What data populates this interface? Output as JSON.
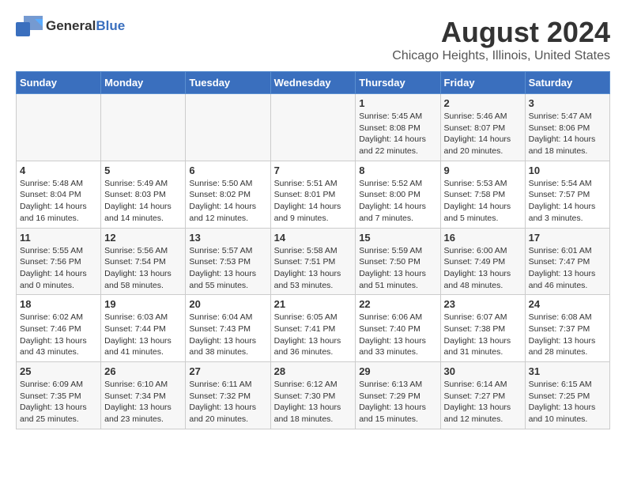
{
  "header": {
    "logo_general": "General",
    "logo_blue": "Blue",
    "title": "August 2024",
    "subtitle": "Chicago Heights, Illinois, United States"
  },
  "days_of_week": [
    "Sunday",
    "Monday",
    "Tuesday",
    "Wednesday",
    "Thursday",
    "Friday",
    "Saturday"
  ],
  "weeks": [
    [
      {
        "day": "",
        "info": ""
      },
      {
        "day": "",
        "info": ""
      },
      {
        "day": "",
        "info": ""
      },
      {
        "day": "",
        "info": ""
      },
      {
        "day": "1",
        "info": "Sunrise: 5:45 AM\nSunset: 8:08 PM\nDaylight: 14 hours\nand 22 minutes."
      },
      {
        "day": "2",
        "info": "Sunrise: 5:46 AM\nSunset: 8:07 PM\nDaylight: 14 hours\nand 20 minutes."
      },
      {
        "day": "3",
        "info": "Sunrise: 5:47 AM\nSunset: 8:06 PM\nDaylight: 14 hours\nand 18 minutes."
      }
    ],
    [
      {
        "day": "4",
        "info": "Sunrise: 5:48 AM\nSunset: 8:04 PM\nDaylight: 14 hours\nand 16 minutes."
      },
      {
        "day": "5",
        "info": "Sunrise: 5:49 AM\nSunset: 8:03 PM\nDaylight: 14 hours\nand 14 minutes."
      },
      {
        "day": "6",
        "info": "Sunrise: 5:50 AM\nSunset: 8:02 PM\nDaylight: 14 hours\nand 12 minutes."
      },
      {
        "day": "7",
        "info": "Sunrise: 5:51 AM\nSunset: 8:01 PM\nDaylight: 14 hours\nand 9 minutes."
      },
      {
        "day": "8",
        "info": "Sunrise: 5:52 AM\nSunset: 8:00 PM\nDaylight: 14 hours\nand 7 minutes."
      },
      {
        "day": "9",
        "info": "Sunrise: 5:53 AM\nSunset: 7:58 PM\nDaylight: 14 hours\nand 5 minutes."
      },
      {
        "day": "10",
        "info": "Sunrise: 5:54 AM\nSunset: 7:57 PM\nDaylight: 14 hours\nand 3 minutes."
      }
    ],
    [
      {
        "day": "11",
        "info": "Sunrise: 5:55 AM\nSunset: 7:56 PM\nDaylight: 14 hours\nand 0 minutes."
      },
      {
        "day": "12",
        "info": "Sunrise: 5:56 AM\nSunset: 7:54 PM\nDaylight: 13 hours\nand 58 minutes."
      },
      {
        "day": "13",
        "info": "Sunrise: 5:57 AM\nSunset: 7:53 PM\nDaylight: 13 hours\nand 55 minutes."
      },
      {
        "day": "14",
        "info": "Sunrise: 5:58 AM\nSunset: 7:51 PM\nDaylight: 13 hours\nand 53 minutes."
      },
      {
        "day": "15",
        "info": "Sunrise: 5:59 AM\nSunset: 7:50 PM\nDaylight: 13 hours\nand 51 minutes."
      },
      {
        "day": "16",
        "info": "Sunrise: 6:00 AM\nSunset: 7:49 PM\nDaylight: 13 hours\nand 48 minutes."
      },
      {
        "day": "17",
        "info": "Sunrise: 6:01 AM\nSunset: 7:47 PM\nDaylight: 13 hours\nand 46 minutes."
      }
    ],
    [
      {
        "day": "18",
        "info": "Sunrise: 6:02 AM\nSunset: 7:46 PM\nDaylight: 13 hours\nand 43 minutes."
      },
      {
        "day": "19",
        "info": "Sunrise: 6:03 AM\nSunset: 7:44 PM\nDaylight: 13 hours\nand 41 minutes."
      },
      {
        "day": "20",
        "info": "Sunrise: 6:04 AM\nSunset: 7:43 PM\nDaylight: 13 hours\nand 38 minutes."
      },
      {
        "day": "21",
        "info": "Sunrise: 6:05 AM\nSunset: 7:41 PM\nDaylight: 13 hours\nand 36 minutes."
      },
      {
        "day": "22",
        "info": "Sunrise: 6:06 AM\nSunset: 7:40 PM\nDaylight: 13 hours\nand 33 minutes."
      },
      {
        "day": "23",
        "info": "Sunrise: 6:07 AM\nSunset: 7:38 PM\nDaylight: 13 hours\nand 31 minutes."
      },
      {
        "day": "24",
        "info": "Sunrise: 6:08 AM\nSunset: 7:37 PM\nDaylight: 13 hours\nand 28 minutes."
      }
    ],
    [
      {
        "day": "25",
        "info": "Sunrise: 6:09 AM\nSunset: 7:35 PM\nDaylight: 13 hours\nand 25 minutes."
      },
      {
        "day": "26",
        "info": "Sunrise: 6:10 AM\nSunset: 7:34 PM\nDaylight: 13 hours\nand 23 minutes."
      },
      {
        "day": "27",
        "info": "Sunrise: 6:11 AM\nSunset: 7:32 PM\nDaylight: 13 hours\nand 20 minutes."
      },
      {
        "day": "28",
        "info": "Sunrise: 6:12 AM\nSunset: 7:30 PM\nDaylight: 13 hours\nand 18 minutes."
      },
      {
        "day": "29",
        "info": "Sunrise: 6:13 AM\nSunset: 7:29 PM\nDaylight: 13 hours\nand 15 minutes."
      },
      {
        "day": "30",
        "info": "Sunrise: 6:14 AM\nSunset: 7:27 PM\nDaylight: 13 hours\nand 12 minutes."
      },
      {
        "day": "31",
        "info": "Sunrise: 6:15 AM\nSunset: 7:25 PM\nDaylight: 13 hours\nand 10 minutes."
      }
    ]
  ]
}
